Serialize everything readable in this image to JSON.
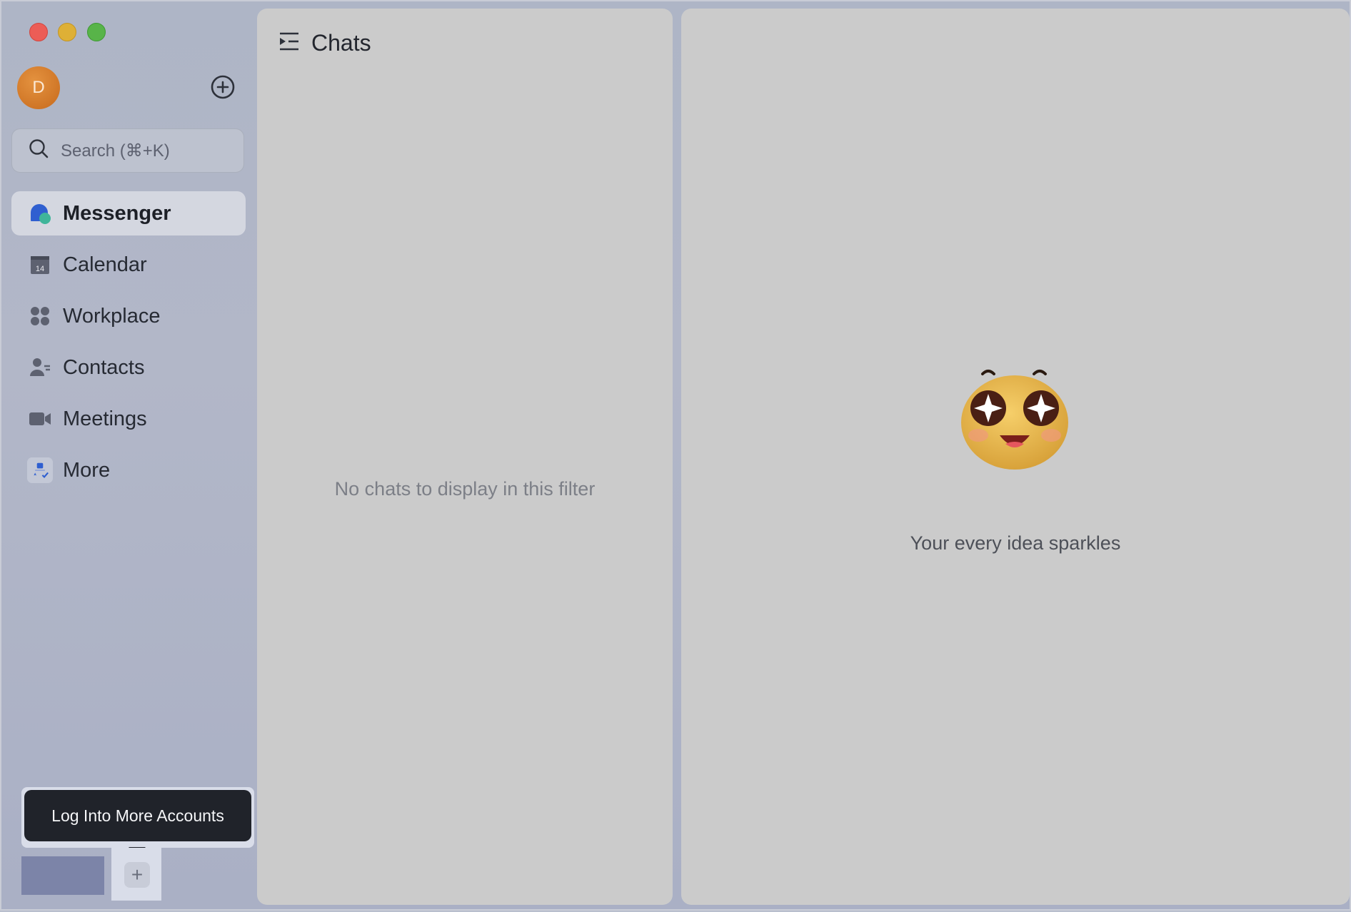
{
  "window": {
    "controls": [
      "close",
      "minimize",
      "zoom"
    ]
  },
  "sidebar": {
    "avatar_initial": "D",
    "search_placeholder": "Search (⌘+K)",
    "items": [
      {
        "label": "Messenger",
        "icon": "messenger-icon",
        "active": true
      },
      {
        "label": "Calendar",
        "icon": "calendar-icon",
        "calendar_day": "14"
      },
      {
        "label": "Workplace",
        "icon": "workplace-icon"
      },
      {
        "label": "Contacts",
        "icon": "contacts-icon"
      },
      {
        "label": "Meetings",
        "icon": "meetings-icon"
      },
      {
        "label": "More",
        "icon": "more-icon"
      }
    ],
    "tooltip": "Log Into More Accounts",
    "add_account_symbol": "+"
  },
  "chats": {
    "title": "Chats",
    "empty_message": "No chats to display in this filter"
  },
  "detail": {
    "emoji": "star-eyes-emoji",
    "slogan": "Your every idea sparkles"
  },
  "colors": {
    "accent_blue": "#2f5fd0",
    "avatar_orange": "#d27a28",
    "tooltip_bg": "#20232a",
    "panel_bg": "#cbcbcb"
  }
}
